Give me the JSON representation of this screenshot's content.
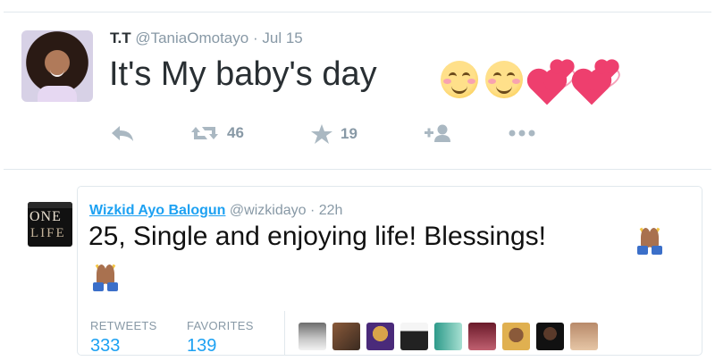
{
  "tweet": {
    "name": "T.T",
    "handle": "@TaniaOmotayo",
    "separator": "·",
    "date": "Jul 15",
    "text": "It's My baby's day",
    "emojis": [
      "smiling-face-with-smiling-eyes",
      "smiling-face-with-smiling-eyes",
      "revolving-hearts",
      "revolving-hearts"
    ],
    "actions": {
      "reply_icon": "reply-icon",
      "retweet_icon": "retweet-icon",
      "retweets": "46",
      "favorite_icon": "star-icon",
      "favorites": "19",
      "follow_icon": "follow-icon",
      "more_icon": "more-icon"
    }
  },
  "quoted": {
    "name": "Wizkid Ayo Balogun",
    "handle": "@wizkidayo",
    "separator": "·",
    "time": "22h",
    "text": "25, Single and enjoying life! Blessings!",
    "emoji": "person-with-folded-hands",
    "avatar_text_1": "ONE",
    "avatar_text_2": "LIFE",
    "stats": {
      "retweets_label": "RETWEETS",
      "retweets_value": "333",
      "favorites_label": "FAVORITES",
      "favorites_value": "139"
    },
    "favoriters_count_shown": 9
  },
  "colors": {
    "link": "#1da1f2",
    "muted": "#8899a6",
    "icon": "#aab8c2",
    "border": "#e1e8ed",
    "heart": "#ee3f6e"
  }
}
